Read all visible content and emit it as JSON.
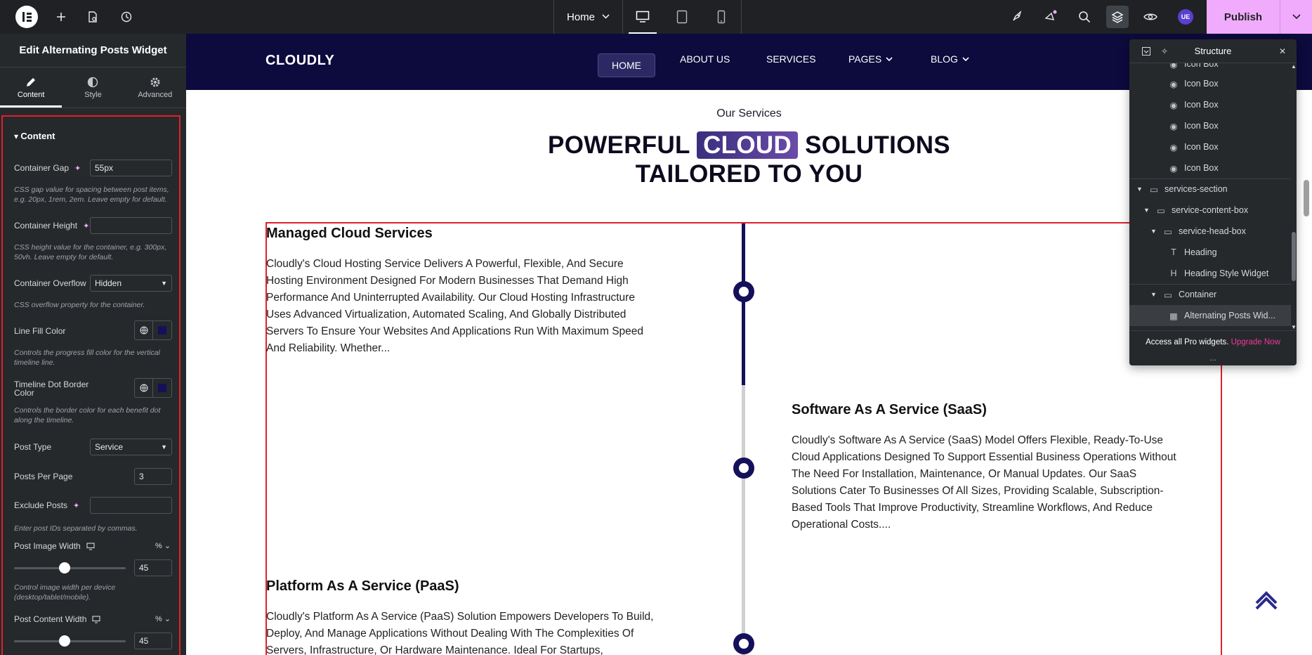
{
  "topbar": {
    "page_selector": "Home",
    "publish_label": "Publish",
    "avatar_initials": "UE"
  },
  "panel": {
    "title": "Edit Alternating Posts Widget",
    "tabs": [
      {
        "label": "Content",
        "icon": "pencil-icon"
      },
      {
        "label": "Style",
        "icon": "half-circle-icon"
      },
      {
        "label": "Advanced",
        "icon": "gear-icon"
      }
    ],
    "section_title": "Content",
    "container_gap": {
      "label": "Container Gap",
      "value": "55px",
      "desc": "CSS gap value for spacing between post items, e.g. 20px, 1rem, 2em. Leave empty for default."
    },
    "container_height": {
      "label": "Container Height",
      "value": "",
      "desc": "CSS height value for the container, e.g. 300px, 50vh. Leave empty for default."
    },
    "container_overflow": {
      "label": "Container Overflow",
      "value": "Hidden",
      "desc": "CSS overflow property for the container."
    },
    "line_fill_color": {
      "label": "Line Fill Color",
      "desc": "Controls the progress fill color for the vertical timeline line.",
      "color": "#14105a"
    },
    "dot_border_color": {
      "label": "Timeline Dot Border Color",
      "desc": "Controls the border color for each benefit dot along the timeline.",
      "color": "#14105a"
    },
    "post_type": {
      "label": "Post Type",
      "value": "Service"
    },
    "posts_per_page": {
      "label": "Posts Per Page",
      "value": "3"
    },
    "exclude_posts": {
      "label": "Exclude Posts",
      "value": "",
      "desc": "Enter post IDs separated by commas."
    },
    "post_image_width": {
      "label": "Post Image Width",
      "unit": "%",
      "value": "45",
      "level": 45,
      "desc": "Control image width per device (desktop/tablet/mobile)."
    },
    "post_content_width": {
      "label": "Post Content Width",
      "unit": "%",
      "value": "45",
      "level": 45
    }
  },
  "site": {
    "brand": "CLOUDLY",
    "nav": [
      "HOME",
      "ABOUT US",
      "SERVICES",
      "PAGES",
      "BLOG"
    ],
    "eyebrow": "Our Services",
    "title_part1": "POWERFUL",
    "title_highlight": "CLOUD",
    "title_part2": "SOLUTIONS",
    "title_line2": "TAILORED TO YOU",
    "posts": [
      {
        "title": "Managed Cloud Services",
        "text": "Cloudly's Cloud Hosting Service Delivers A Powerful, Flexible, And Secure Hosting Environment Designed For Modern Businesses That Demand High Performance And Uninterrupted Availability. Our Cloud Hosting Infrastructure Uses Advanced Virtualization, Automated Scaling, And Globally Distributed Servers To Ensure Your Websites And Applications Run With Maximum Speed And Reliability. Whether..."
      },
      {
        "title": "Software As A Service (SaaS)",
        "text": "Cloudly's Software As A Service (SaaS) Model Offers Flexible, Ready-To-Use Cloud Applications Designed To Support Essential Business Operations Without The Need For Installation, Maintenance, Or Manual Updates. Our SaaS Solutions Cater To Businesses Of All Sizes, Providing Scalable, Subscription-Based Tools That Improve Productivity, Streamline Workflows, And Reduce Operational Costs...."
      },
      {
        "title": "Platform As A Service (PaaS)",
        "text": "Cloudly's Platform As A Service (PaaS) Solution Empowers Developers To Build, Deploy, And Manage Applications Without Dealing With The Complexities Of Servers, Infrastructure, Or Hardware Maintenance. Ideal For Startups,"
      }
    ]
  },
  "structure": {
    "title": "Structure",
    "rows": [
      {
        "label": "Icon Box"
      },
      {
        "label": "Icon Box"
      },
      {
        "label": "Icon Box"
      },
      {
        "label": "Icon Box"
      },
      {
        "label": "Icon Box"
      },
      {
        "label": "Icon Box"
      },
      {
        "label": "services-section"
      },
      {
        "label": "service-content-box"
      },
      {
        "label": "service-head-box"
      },
      {
        "label": "Heading"
      },
      {
        "label": "Heading Style Widget"
      },
      {
        "label": "Container"
      },
      {
        "label": "Alternating Posts Wid..."
      }
    ],
    "footer_text": "Access all Pro widgets.",
    "footer_link": "Upgrade Now",
    "more": "..."
  }
}
